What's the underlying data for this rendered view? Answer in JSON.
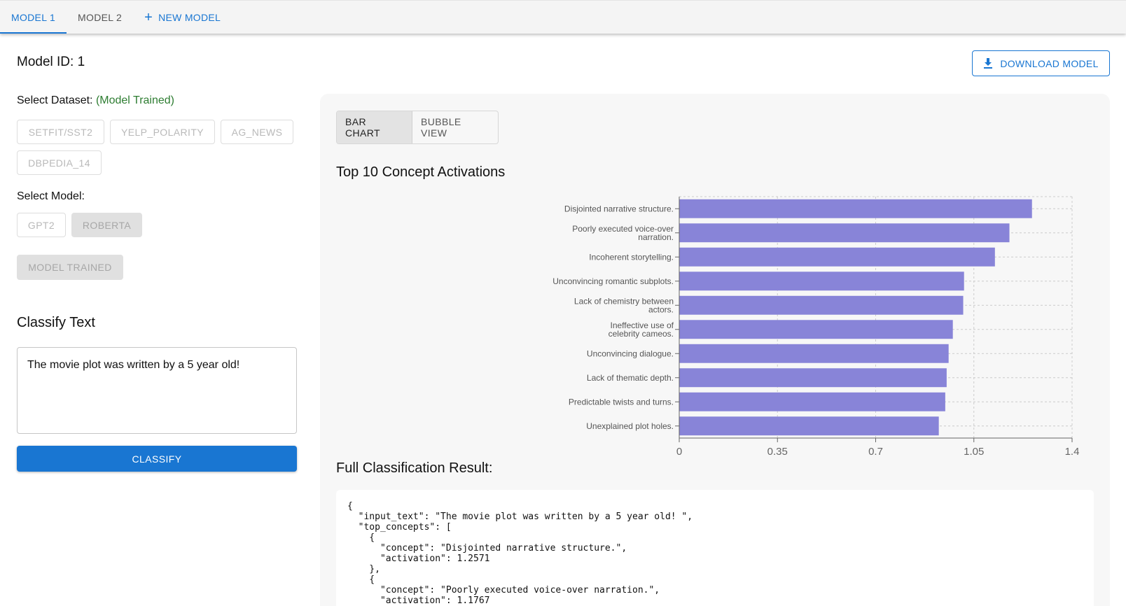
{
  "tabs": [
    {
      "label": "MODEL 1",
      "active": true
    },
    {
      "label": "MODEL 2",
      "active": false
    }
  ],
  "new_model_label": "NEW MODEL",
  "model_id_text": "Model ID: 1",
  "download_label": "DOWNLOAD MODEL",
  "dataset": {
    "label": "Select Dataset:",
    "status": "(Model Trained)",
    "options": [
      "SETFIT/SST2",
      "YELP_POLARITY",
      "AG_NEWS",
      "DBPEDIA_14"
    ]
  },
  "model_select": {
    "label": "Select Model:",
    "options": [
      "GPT2",
      "ROBERTA"
    ]
  },
  "trained_button_label": "MODEL TRAINED",
  "classify": {
    "title": "Classify Text",
    "input_value": "The movie plot was written by a 5 year old!",
    "button_label": "CLASSIFY"
  },
  "view_toggle": [
    "BAR CHART",
    "BUBBLE VIEW"
  ],
  "chart_title": "Top 10 Concept Activations",
  "chart_data": {
    "type": "bar",
    "orientation": "horizontal",
    "categories": [
      "Disjointed narrative structure.",
      "Poorly executed voice-over narration.",
      "Incoherent storytelling.",
      "Unconvincing romantic subplots.",
      "Lack of chemistry between actors.",
      "Ineffective use of celebrity cameos.",
      "Unconvincing dialogue.",
      "Lack of thematic depth.",
      "Predictable twists and turns.",
      "Unexplained plot holes."
    ],
    "values": [
      1.2571,
      1.1767,
      1.125,
      1.015,
      1.012,
      0.975,
      0.96,
      0.953,
      0.948,
      0.925
    ],
    "xlim": [
      0,
      1.4
    ],
    "xticks": [
      "0",
      "0.35",
      "0.7",
      "1.05",
      "1.4"
    ],
    "bar_color": "#8884d8",
    "grid": true
  },
  "result": {
    "title": "Full Classification Result:",
    "json_text": "{\n  \"input_text\": \"The movie plot was written by a 5 year old! \",\n  \"top_concepts\": [\n    {\n      \"concept\": \"Disjointed narrative structure.\",\n      \"activation\": 1.2571\n    },\n    {\n      \"concept\": \"Poorly executed voice-over narration.\",\n      \"activation\": 1.1767"
  },
  "colors": {
    "accent": "#1976d2",
    "trained_green": "#2e7d32"
  }
}
